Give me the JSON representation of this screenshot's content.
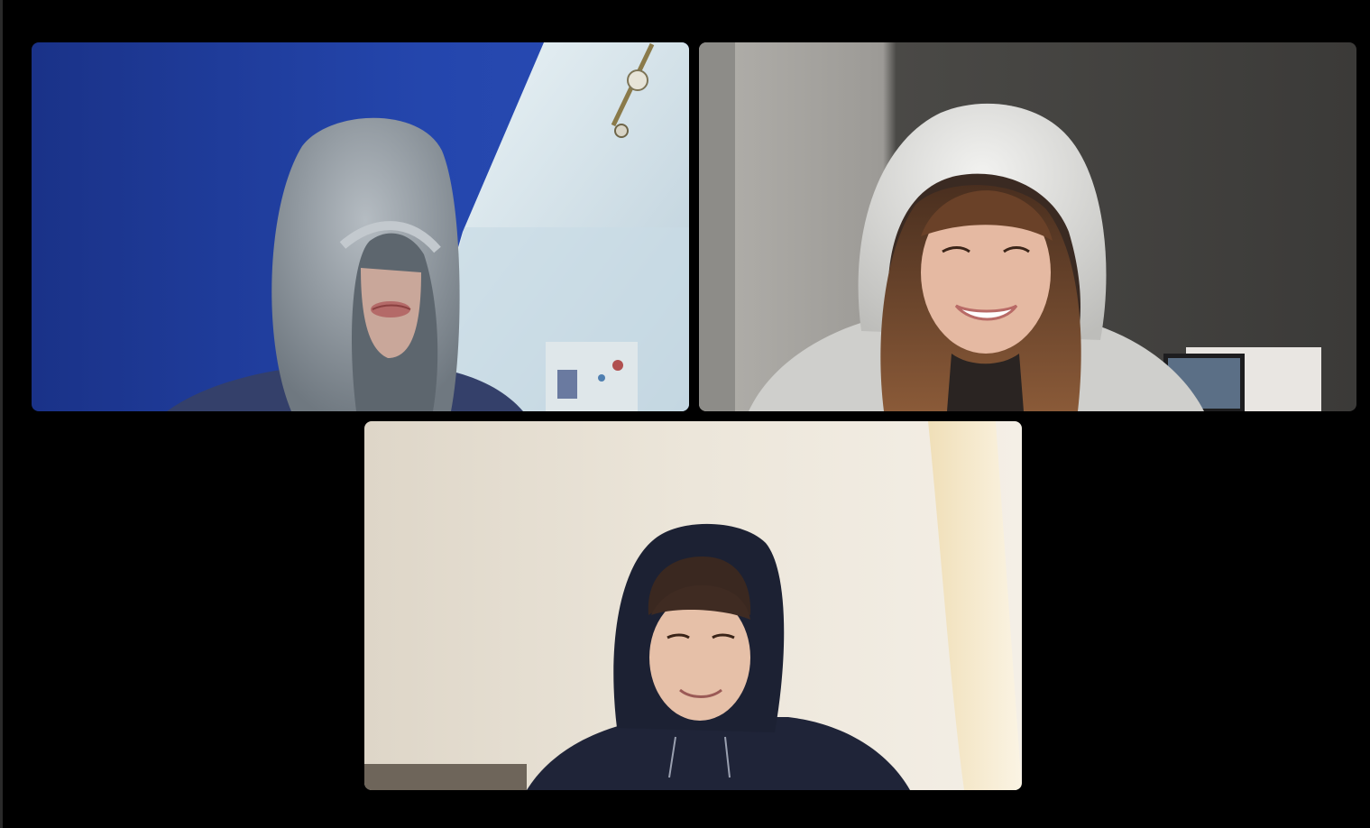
{
  "meeting": {
    "view": "gallery",
    "participants": [
      {
        "tile": 1,
        "camera": "on",
        "hood_color": "#9aa1a8",
        "background_color": "#1e3e9e"
      },
      {
        "tile": 2,
        "camera": "on",
        "hood_color": "#e2e2e0",
        "background_color": "#4c4b48"
      },
      {
        "tile": 3,
        "camera": "on",
        "hood_color": "#1c2133",
        "background_color": "#ece4d6"
      }
    ]
  },
  "colors": {
    "app_background": "#000000",
    "tile_radius_style": "rounded"
  }
}
